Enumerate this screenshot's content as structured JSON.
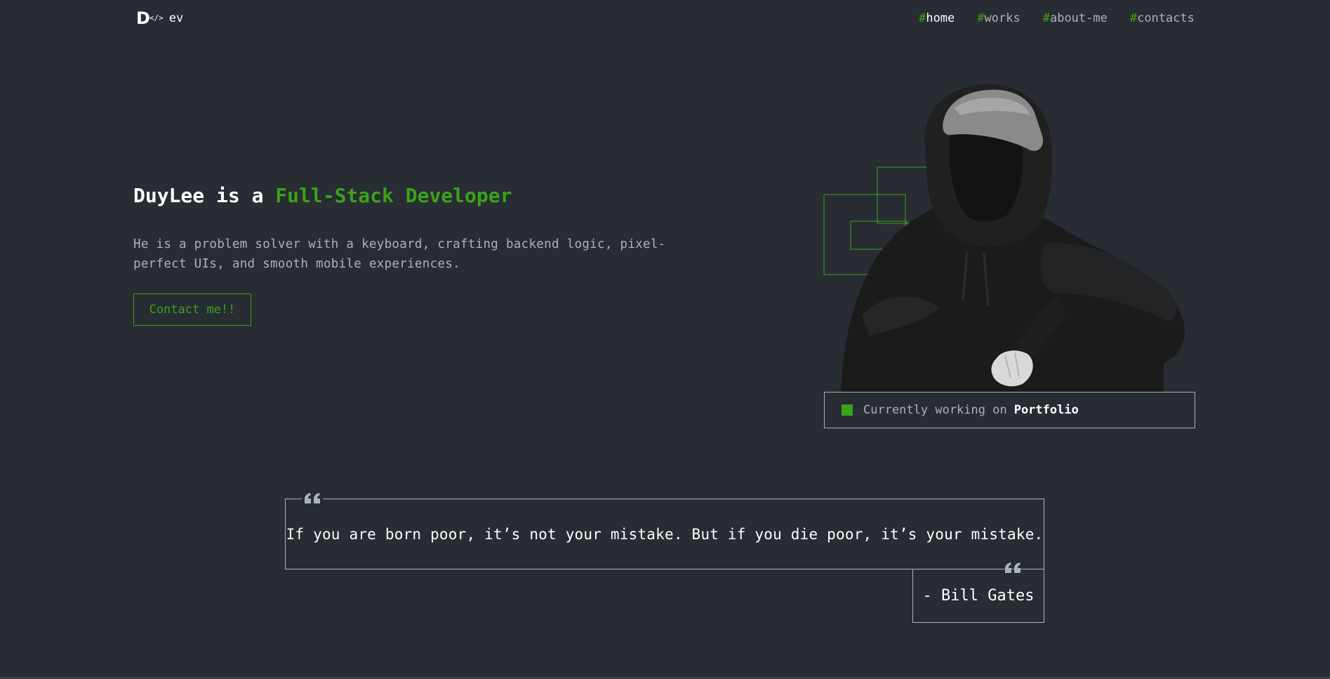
{
  "colors": {
    "background": "#282c33",
    "accent": "#3aa317",
    "text": "#abb2bf",
    "heading": "#ffffff"
  },
  "header": {
    "logo": {
      "mark": "D",
      "code_icon": "</>",
      "text": "ev"
    },
    "nav": [
      {
        "hash": "#",
        "label": "home",
        "active": true
      },
      {
        "hash": "#",
        "label": "works",
        "active": false
      },
      {
        "hash": "#",
        "label": "about-me",
        "active": false
      },
      {
        "hash": "#",
        "label": "contacts",
        "active": false
      }
    ]
  },
  "hero": {
    "title_prefix": "DuyLee is a ",
    "title_highlight": "Full-Stack Developer",
    "description": "He is a problem solver with a keyboard, crafting backend logic, pixel-perfect UIs, and smooth mobile experiences.",
    "contact_button": "Contact me!!"
  },
  "status": {
    "icon": "green-square-icon",
    "prefix": "Currently working on",
    "project": "Portfolio"
  },
  "quote": {
    "icon": "quote-mark-icon",
    "text": "If you are born poor, it’s not your mistake. But if you die poor, it’s your mistake.",
    "author": "- Bill Gates"
  }
}
